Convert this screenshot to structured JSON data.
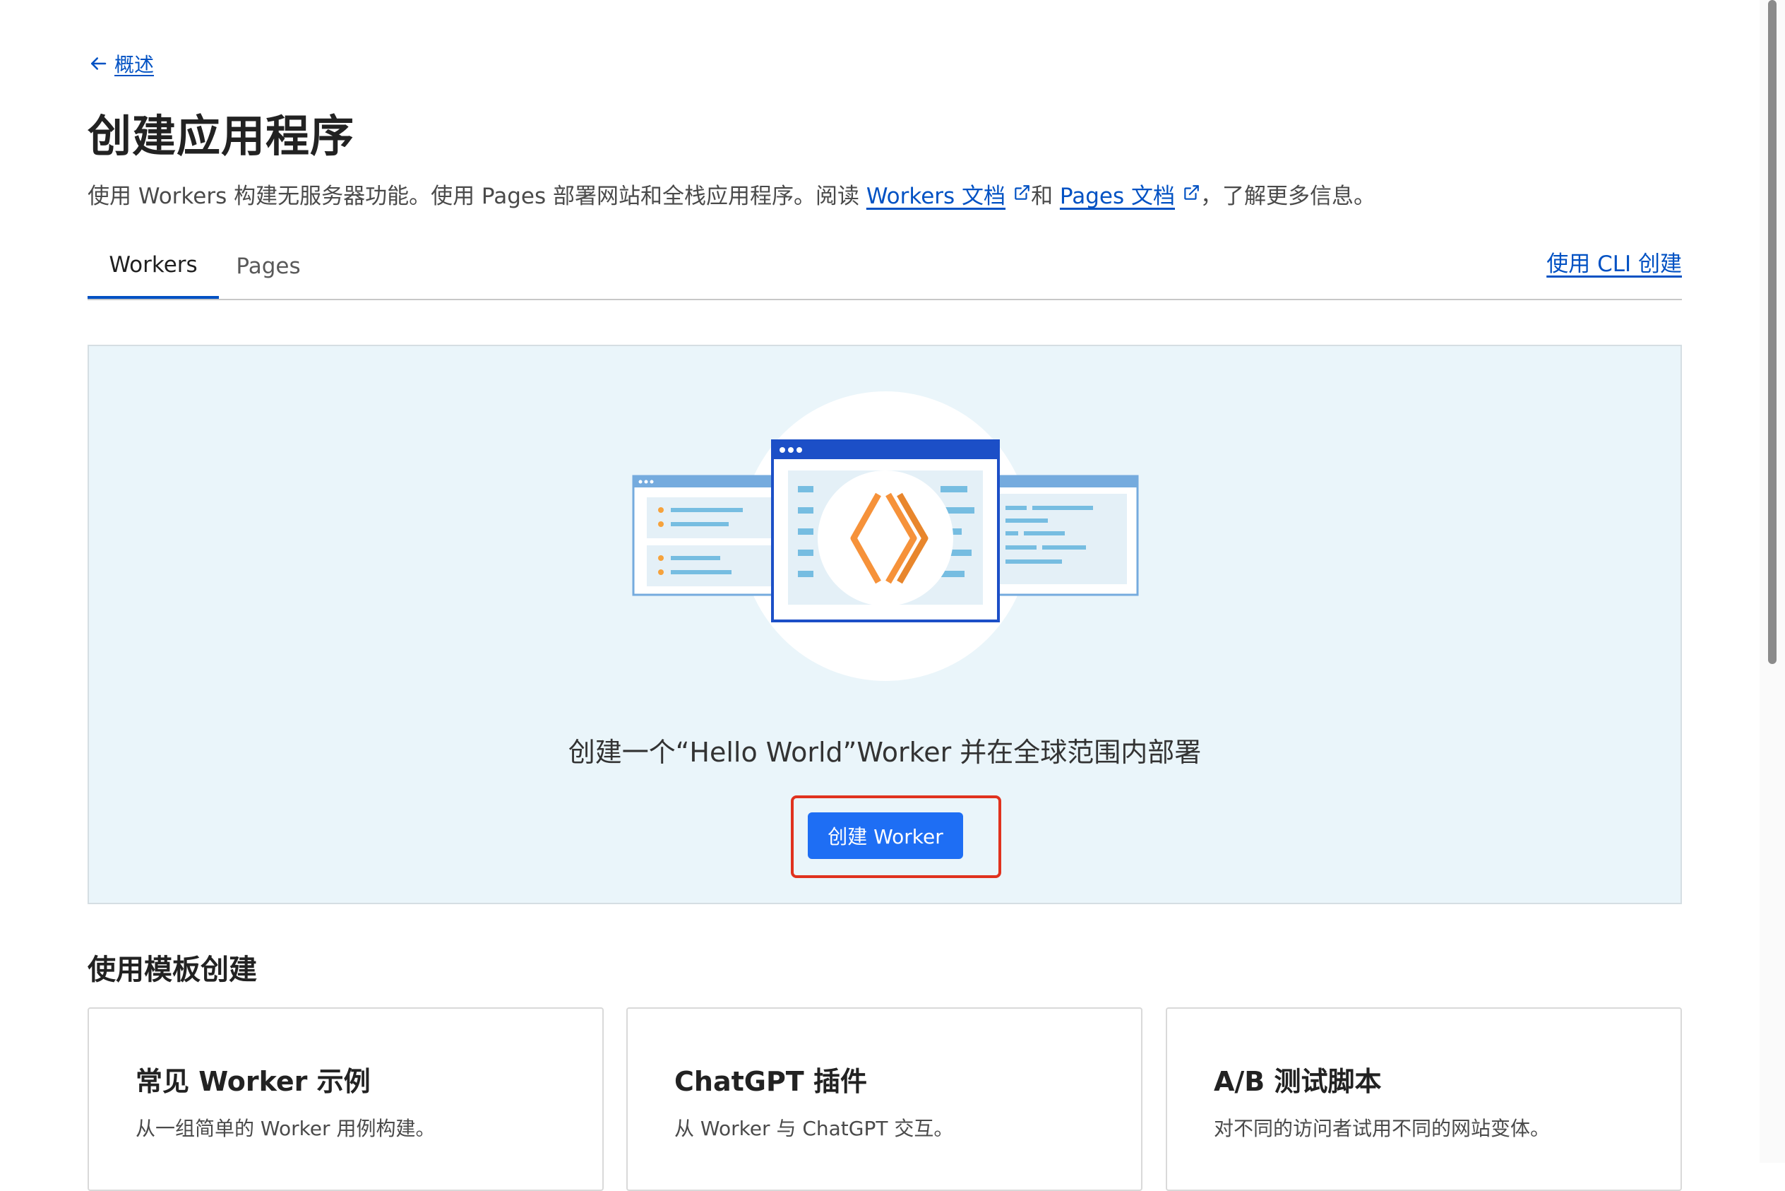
{
  "nav": {
    "back_label": "概述",
    "back_icon": "arrow-left-icon"
  },
  "page": {
    "title": "创建应用程序",
    "intro_before": "使用 Workers 构建无服务器功能。使用 Pages 部署网站和全栈应用程序。阅读 ",
    "workers_docs_label": "Workers 文档",
    "intro_middle": "和 ",
    "pages_docs_label": "Pages 文档",
    "intro_after": "，了解更多信息。",
    "external_icon": "external-link-icon"
  },
  "tabs": [
    {
      "label": "Workers",
      "active": true
    },
    {
      "label": "Pages",
      "active": false
    }
  ],
  "cli_link_label": "使用 CLI 创建",
  "hero": {
    "text": "创建一个“Hello World”Worker 并在全球范围内部署",
    "button_label": "创建 Worker",
    "illustration_icon": "workers-code-brackets-icon",
    "highlight_color": "#e0321e"
  },
  "templates": {
    "section_title": "使用模板创建",
    "cards": [
      {
        "title": "常见 Worker 示例",
        "description": "从一组简单的 Worker 用例构建。"
      },
      {
        "title": "ChatGPT 插件",
        "description": "从 Worker 与 ChatGPT 交互。"
      },
      {
        "title": "A/B 测试脚本",
        "description": "对不同的访问者试用不同的网站变体。"
      }
    ]
  },
  "colors": {
    "link": "#0051c3",
    "primary_button": "#1e6ef4",
    "hero_background": "#eaf5fa",
    "accent_orange": "#f38020"
  }
}
